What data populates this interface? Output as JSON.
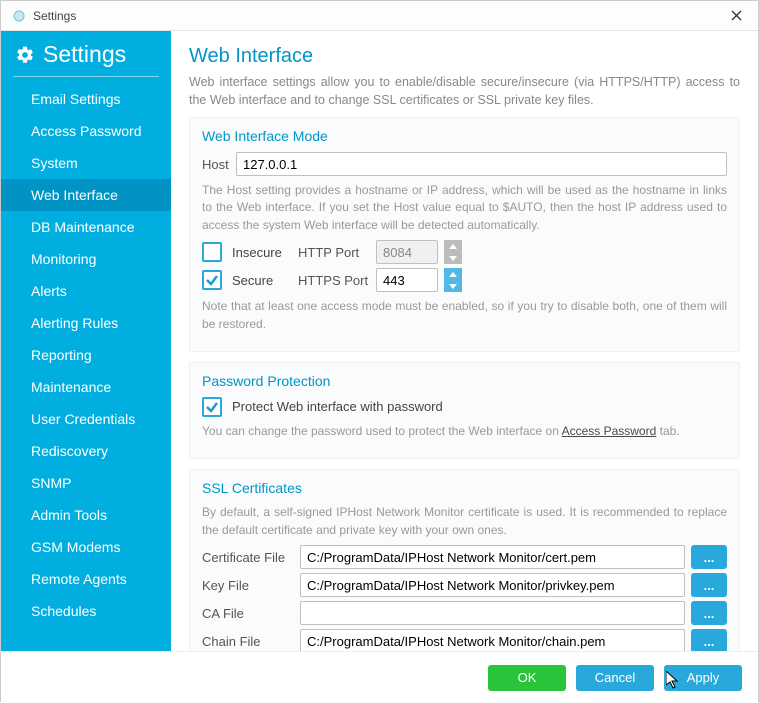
{
  "window": {
    "title": "Settings"
  },
  "sidebar": {
    "header": "Settings",
    "items": [
      {
        "label": "Email Settings"
      },
      {
        "label": "Access Password"
      },
      {
        "label": "System"
      },
      {
        "label": "Web Interface"
      },
      {
        "label": "DB Maintenance"
      },
      {
        "label": "Monitoring"
      },
      {
        "label": "Alerts"
      },
      {
        "label": "Alerting Rules"
      },
      {
        "label": "Reporting"
      },
      {
        "label": "Maintenance"
      },
      {
        "label": "User Credentials"
      },
      {
        "label": "Rediscovery"
      },
      {
        "label": "SNMP"
      },
      {
        "label": "Admin Tools"
      },
      {
        "label": "GSM Modems"
      },
      {
        "label": "Remote Agents"
      },
      {
        "label": "Schedules"
      }
    ],
    "activeIndex": "3"
  },
  "page": {
    "title": "Web Interface",
    "desc": "Web interface settings allow you to enable/disable secure/insecure (via HTTPS/HTTP) access to the Web interface and to change SSL certificates or SSL private key files."
  },
  "mode": {
    "title": "Web Interface Mode",
    "host_label": "Host",
    "host_value": "127.0.0.1",
    "host_help": "The Host setting provides a hostname or IP address, which will be used as the hostname in links to the Web interface. If you set the Host value equal to $AUTO, then the host IP address used to access the system Web interface will be detected automatically.",
    "insecure_label": "Insecure",
    "http_port_label": "HTTP Port",
    "http_port_value": "8084",
    "secure_label": "Secure",
    "https_port_label": "HTTPS Port",
    "https_port_value": "443",
    "note": "Note that at least one access mode must be enabled, so if you try to disable both, one of them will be restored."
  },
  "password": {
    "title": "Password Protection",
    "checkbox_label": "Protect Web interface with password",
    "help_prefix": "You can change the password used to protect the Web interface on ",
    "link_text": "Access Password",
    "help_suffix": " tab."
  },
  "ssl": {
    "title": "SSL Certificates",
    "help": "By default, a self-signed IPHost Network Monitor certificate is used. It is recommended to replace the default certificate and private key with your own ones.",
    "cert_label": "Certificate File",
    "cert_value": "C:/ProgramData/IPHost Network Monitor/cert.pem",
    "key_label": "Key File",
    "key_value": "C:/ProgramData/IPHost Network Monitor/privkey.pem",
    "ca_label": "CA File",
    "ca_value": "",
    "chain_label": "Chain File",
    "chain_value": "C:/ProgramData/IPHost Network Monitor/chain.pem",
    "browse": "..."
  },
  "footer": {
    "ok": "OK",
    "cancel": "Cancel",
    "apply": "Apply"
  }
}
